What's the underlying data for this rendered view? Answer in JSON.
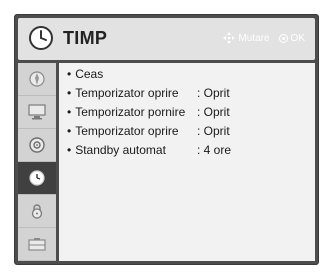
{
  "header": {
    "title": "TIMP",
    "move_hint": "Mutare",
    "ok_hint": "OK",
    "icon": "clock-icon"
  },
  "sidebar": {
    "items": [
      {
        "icon": "picture-icon",
        "active": false
      },
      {
        "icon": "monitor-icon",
        "active": false
      },
      {
        "icon": "audio-icon",
        "active": false
      },
      {
        "icon": "clock-icon",
        "active": true
      },
      {
        "icon": "lock-icon",
        "active": false
      },
      {
        "icon": "option-icon",
        "active": false
      }
    ]
  },
  "menu": {
    "items": [
      {
        "label": "Ceas",
        "value": ""
      },
      {
        "label": "Temporizator oprire",
        "value": "Oprit"
      },
      {
        "label": "Temporizator pornire",
        "value": "Oprit"
      },
      {
        "label": "Temporizator oprire",
        "value": "Oprit"
      },
      {
        "label": "Standby automat",
        "value": "4 ore"
      }
    ]
  },
  "colors": {
    "frame": "#4d4d4d",
    "header_bg": "#e2e2e2",
    "content_bg": "#f2f2f2",
    "sidebar_bg": "#d3d3d3",
    "sidebar_active": "#404040"
  }
}
